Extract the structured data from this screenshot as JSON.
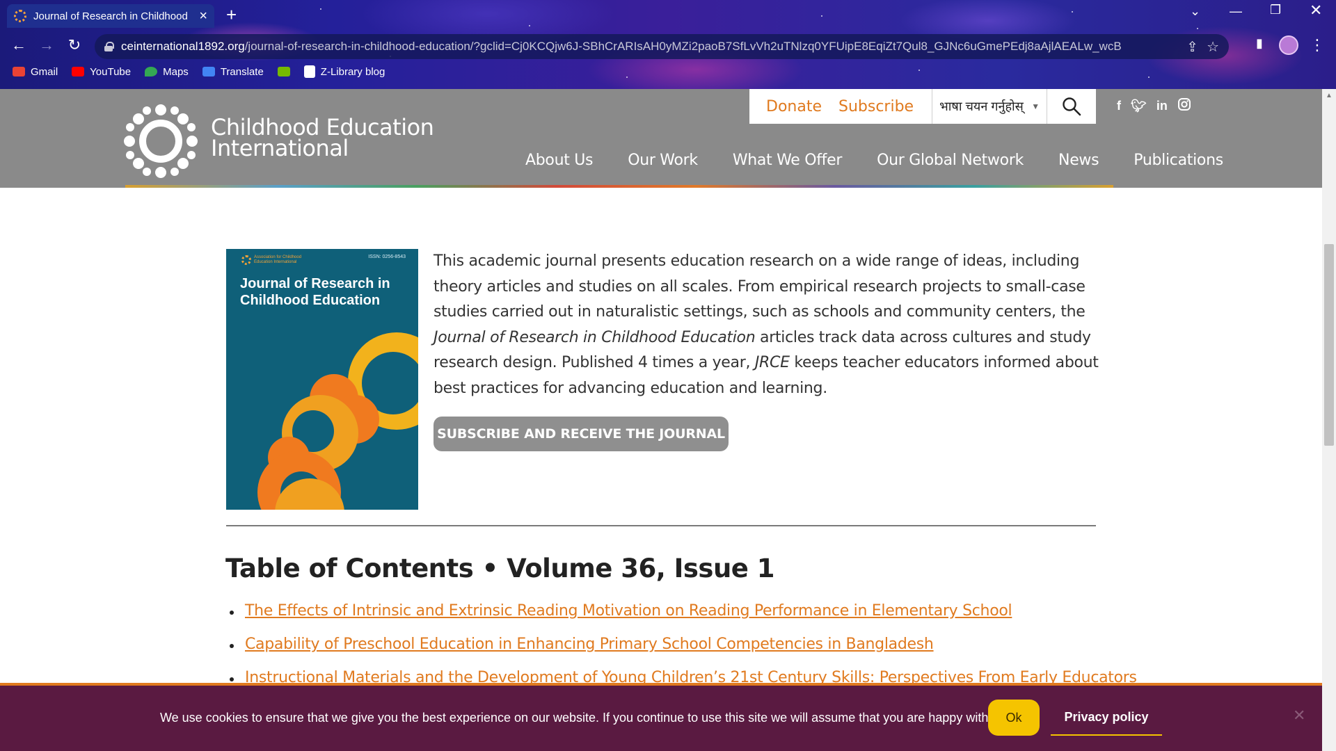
{
  "browser": {
    "tab_title": "Journal of Research in Childhood",
    "url_host": "ceinternational1892.org",
    "url_path": "/journal-of-research-in-childhood-education/?gclid=Cj0KCQjw6J-SBhCrARIsAH0yMZi2paoB7SfLvVh2uTNlzq0YFUipE8EqiZt7Qul8_GJNc6uGmePEdj8aAjlAEALw_wcB",
    "bookmarks": [
      {
        "label": "Gmail",
        "color": "#ea4335"
      },
      {
        "label": "YouTube",
        "color": "#ff0000"
      },
      {
        "label": "Maps",
        "color": "#34a853"
      },
      {
        "label": "Translate",
        "color": "#4285f4"
      },
      {
        "label": "",
        "color": "#76b900"
      },
      {
        "label": "Z-Library blog",
        "color": "#ffffff"
      }
    ]
  },
  "header": {
    "brand_line1": "Childhood Education",
    "brand_line2": "International",
    "donate": "Donate",
    "subscribe": "Subscribe",
    "language_select": "भाषा चयन गर्नुहोस्",
    "social": [
      "f",
      "t",
      "in",
      "ig"
    ],
    "nav": [
      "About Us",
      "Our Work",
      "What We Offer",
      "Our Global Network",
      "News",
      "Publications"
    ]
  },
  "cover": {
    "issn": "ISSN: 0256-8543",
    "publisher": "Association for Childhood Education International",
    "title_line1": "Journal of Research in",
    "title_line2": "Childhood Education"
  },
  "intro": {
    "p1": "This academic journal presents education research on a wide range of ideas, including theory articles and studies on all scales. From empirical research projects to small-case studies carried out in naturalistic settings, such as schools and community centers, the ",
    "journal_italic": "Journal of Research in Childhood Education",
    "p2": " articles track data across cultures and study research design. Published 4 times a year, ",
    "abbr_italic": "JRCE",
    "p3": " keeps teacher educators informed about best practices for advancing education and learning."
  },
  "subscribe_button": "SUBSCRIBE AND RECEIVE THE JOURNAL",
  "toc": {
    "title": "Table of Contents • Volume 36, Issue 1",
    "items": [
      "The Effects of Intrinsic and Extrinsic Reading Motivation on Reading Performance in Elementary School",
      "Capability of Preschool Education in Enhancing Primary School Competencies in Bangladesh",
      "Instructional Materials and the Development of Young Children’s 21st Century Skills: Perspectives From Early Educators"
    ]
  },
  "cookie": {
    "text": "We use cookies to ensure that we give you the best experience on our website. If you continue to use this site we will assume that you are happy with it.",
    "ok": "Ok",
    "privacy": "Privacy policy"
  },
  "colors": {
    "accent": "#e07a1f",
    "header_bg": "#8a8a8a",
    "cookie_bg": "#5a1a41",
    "ok_bg": "#f5c400",
    "cover_bg": "#0f6079"
  }
}
